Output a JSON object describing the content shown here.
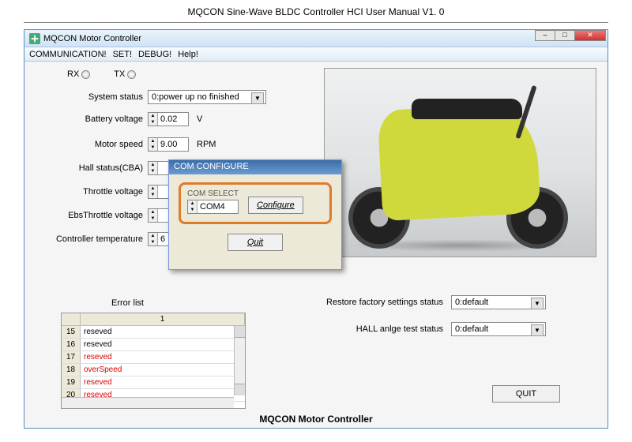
{
  "page_header": "MQCON Sine-Wave BLDC Controller HCI User Manual V1. 0",
  "window": {
    "title": "MQCON Motor Controller"
  },
  "menu": {
    "communication": "COMMUNICATION!",
    "set": "SET!",
    "debug": "DEBUG!",
    "help": "Help!"
  },
  "indicators": {
    "rx": "RX",
    "tx": "TX"
  },
  "fields": {
    "system_status_label": "System status",
    "system_status_value": "0:power up no finished",
    "battery_voltage_label": "Battery voltage",
    "battery_voltage_value": "0.02",
    "battery_voltage_unit": "V",
    "motor_speed_label": "Motor speed",
    "motor_speed_value": "9.00",
    "motor_speed_unit": "RPM",
    "hall_status_label": "Hall status(CBA)",
    "throttle_voltage_label": "Throttle voltage",
    "ebs_throttle_label": "EbsThrottle voltage",
    "ctrl_temp_label": "Controller temperature",
    "ctrl_temp_value": "6"
  },
  "dialog": {
    "title": "COM CONFIGURE",
    "com_select_label": "COM SELECT",
    "com_value": "COM4",
    "configure_btn": "Configure",
    "quit_btn": "Quit"
  },
  "error_section": {
    "label": "Error list",
    "header_col": "1",
    "rows": [
      {
        "n": "15",
        "v": "reseved",
        "err": false
      },
      {
        "n": "16",
        "v": "reseved",
        "err": false
      },
      {
        "n": "17",
        "v": "reseved",
        "err": true
      },
      {
        "n": "18",
        "v": "overSpeed",
        "err": true
      },
      {
        "n": "19",
        "v": "reseved",
        "err": true
      },
      {
        "n": "20",
        "v": "reseved",
        "err": true
      }
    ]
  },
  "status": {
    "restore_label": "Restore factory settings status",
    "restore_value": "0:default",
    "hall_label": "HALL anlge test status",
    "hall_value": "0:default"
  },
  "quit_main": "QUIT",
  "footer": "MQCON Motor Controller"
}
